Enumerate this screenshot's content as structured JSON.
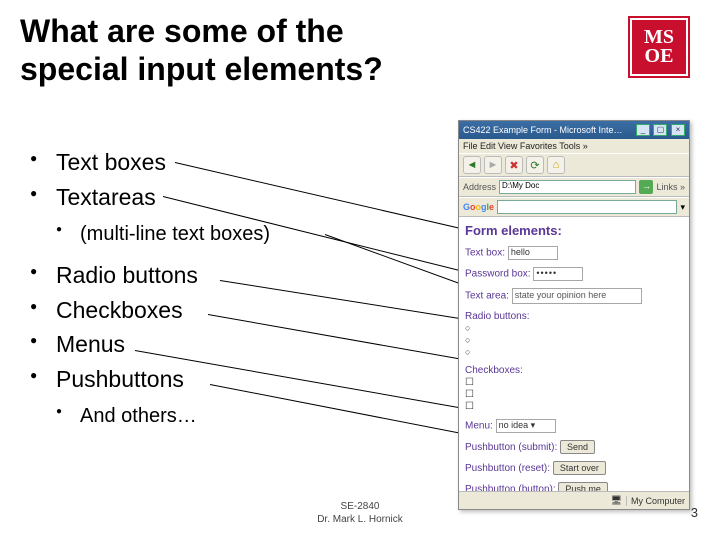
{
  "title": "What are some of the special input elements?",
  "logo": {
    "line1": "MS",
    "line2": "OE"
  },
  "bullets": {
    "b0": "Text boxes",
    "b1": "Textareas",
    "b1_sub": "(multi-line text boxes)",
    "b2": "Radio buttons",
    "b3": "Checkboxes",
    "b4": "Menus",
    "b5": "Pushbuttons",
    "b5_sub": "And others…"
  },
  "footer": {
    "course": "SE-2840",
    "author": "Dr. Mark L. Hornick"
  },
  "page_number": "3",
  "browser": {
    "title": "CS422 Example Form - Microsoft Inte…",
    "menu": "File  Edit  View  Favorites  Tools  »",
    "addr_label": "Address",
    "addr_value": "D:\\My Doc",
    "links_label": "Links »",
    "google_input": "",
    "form": {
      "heading": "Form elements:",
      "textbox_label": "Text box:",
      "textbox_value": "hello",
      "password_label": "Password box:",
      "password_value": "•••••",
      "textarea_label": "Text area:",
      "textarea_value": "state your opinion here",
      "radio_label": "Radio buttons:",
      "check_label": "Checkboxes:",
      "menu_label": "Menu:",
      "menu_value": "no idea",
      "submit_label": "Pushbutton (submit):",
      "submit_btn": "Send",
      "reset_label": "Pushbutton (reset):",
      "reset_btn": "Start over",
      "button_label": "Pushbutton (button):",
      "button_btn": "Push me"
    },
    "status": "My Computer"
  }
}
